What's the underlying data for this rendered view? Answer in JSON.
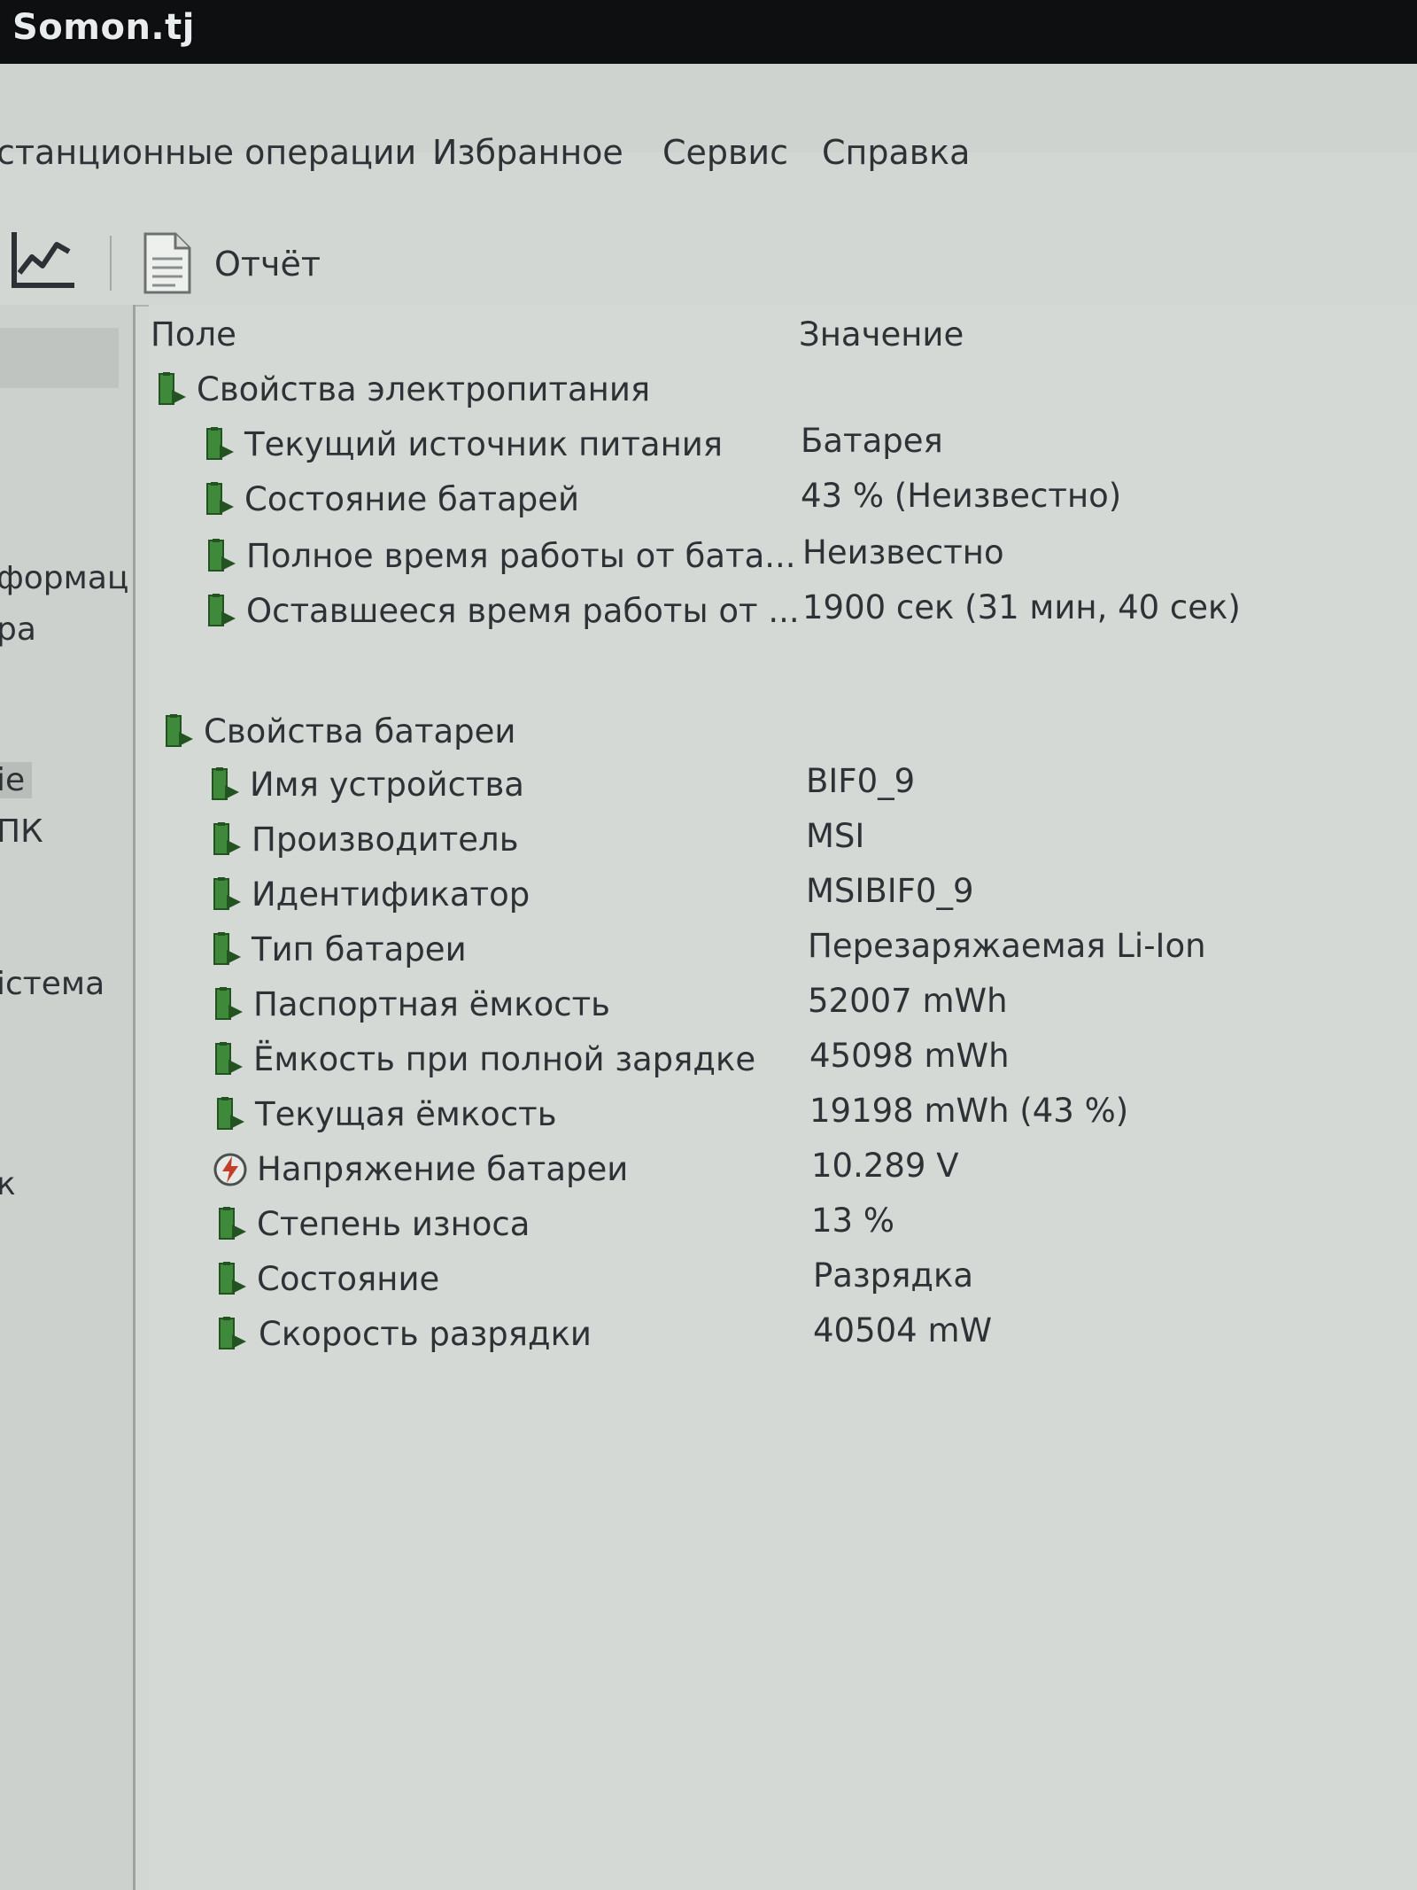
{
  "watermark": "Somon.tj",
  "menu": {
    "items": [
      {
        "label": "станционные операции"
      },
      {
        "label": "Избранное"
      },
      {
        "label": "Сервис"
      },
      {
        "label": "Справка"
      }
    ]
  },
  "toolbar": {
    "chart_icon": "line-chart-icon",
    "report_label": "Отчёт",
    "report_icon": "document-icon"
  },
  "left_pane": {
    "items": [
      {
        "label": "формац"
      },
      {
        "label": "ра"
      },
      {
        "label": "ie"
      },
      {
        "label": "ПК"
      },
      {
        "label": "істема"
      },
      {
        "label": "к"
      }
    ]
  },
  "table": {
    "col_field": "Поле",
    "col_value": "Значение",
    "groups": [
      {
        "title": "Свойства электропитания",
        "rows": [
          {
            "field": "Текущий источник питания",
            "value": "Батарея"
          },
          {
            "field": "Состояние батарей",
            "value": "43 % (Неизвестно)"
          },
          {
            "field": "Полное время работы от бата...",
            "value": "Неизвестно"
          },
          {
            "field": "Оставшееся время работы от ...",
            "value": "1900 сек (31 мин, 40 сек)"
          }
        ]
      },
      {
        "title": "Свойства батареи",
        "rows": [
          {
            "field": "Имя устройства",
            "value": "BIF0_9"
          },
          {
            "field": "Производитель",
            "value": "MSI"
          },
          {
            "field": "Идентификатор",
            "value": "MSIBIF0_9"
          },
          {
            "field": "Тип батареи",
            "value": "Перезаряжаемая Li-Ion"
          },
          {
            "field": "Паспортная ёмкость",
            "value": "52007 mWh"
          },
          {
            "field": "Ёмкость при полной зарядке",
            "value": "45098 mWh"
          },
          {
            "field": "Текущая ёмкость",
            "value": "19198 mWh  (43 %)"
          },
          {
            "field": "Напряжение батареи",
            "value": "10.289 V"
          },
          {
            "field": "Степень износа",
            "value": "13 %"
          },
          {
            "field": "Состояние",
            "value": "Разрядка"
          },
          {
            "field": "Скорость разрядки",
            "value": "40504 mW"
          }
        ]
      }
    ]
  },
  "icons": {
    "battery": "battery-icon",
    "voltage": "voltage-icon"
  },
  "colors": {
    "battery_green": "#3f8a3a",
    "battery_dark": "#245322",
    "voltage_red": "#c2402a"
  }
}
